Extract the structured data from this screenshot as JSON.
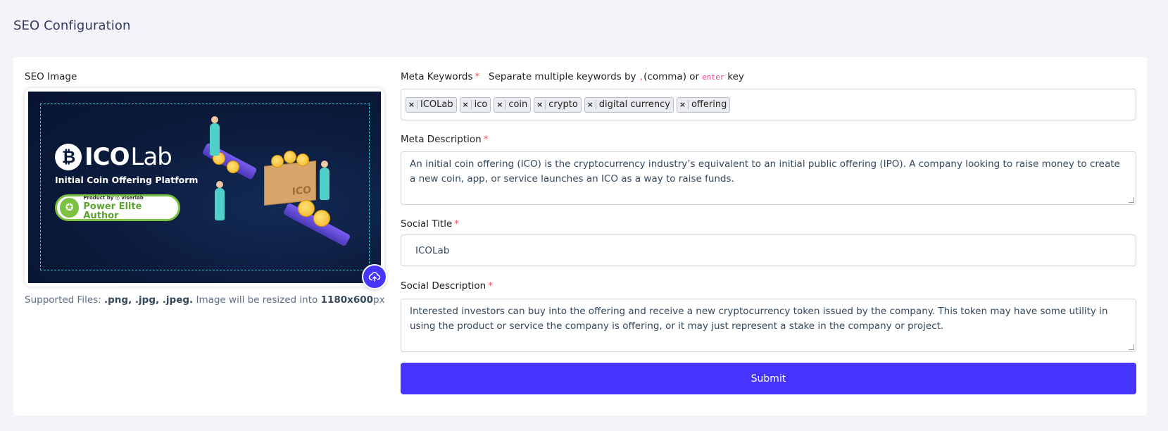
{
  "page": {
    "title": "SEO Configuration"
  },
  "seo_image": {
    "label": "SEO Image",
    "banner": {
      "logo_prefix": "ICO",
      "logo_suffix": "Lab",
      "logo_mark": "₿",
      "subtitle": "Initial Coin Offering Platform",
      "badge_small": "Product by ◎ viserlab",
      "badge_big": "Power Elite Author",
      "box_text": "ICO"
    },
    "upload_icon": "cloud-upload-icon",
    "hint_prefix": "Supported Files: ",
    "hint_formats": ".png, .jpg, .jpeg.",
    "hint_middle": " Image will be resized into ",
    "hint_size": "1180x600",
    "hint_unit": "px"
  },
  "meta_keywords": {
    "label": "Meta Keywords",
    "required": "*",
    "hint_before": "Separate multiple keywords by ",
    "hint_code1": ",",
    "hint_middle": "(comma) or ",
    "hint_code2": "enter",
    "hint_after": " key",
    "tags": [
      "ICOLab",
      "ico",
      "coin",
      "crypto",
      "digital currency",
      "offering"
    ],
    "remove_symbol": "×"
  },
  "meta_description": {
    "label": "Meta Description",
    "required": "*",
    "value": "An initial coin offering (ICO) is the cryptocurrency industry’s equivalent to an initial public offering (IPO). A company looking to raise money to create a new coin, app, or service launches an ICO as a way to raise funds."
  },
  "social_title": {
    "label": "Social Title",
    "required": "*",
    "value": "ICOLab"
  },
  "social_description": {
    "label": "Social Description",
    "required": "*",
    "value": "Interested investors can buy into the offering and receive a new cryptocurrency token issued by the company. This token may have some utility in using the product or service the company is offering, or it may just represent a stake in the company or project."
  },
  "submit": {
    "label": "Submit"
  },
  "colors": {
    "primary": "#4634ff",
    "required": "#ea5455",
    "background": "#f3f3f9",
    "badge_green": "#7cc242"
  }
}
